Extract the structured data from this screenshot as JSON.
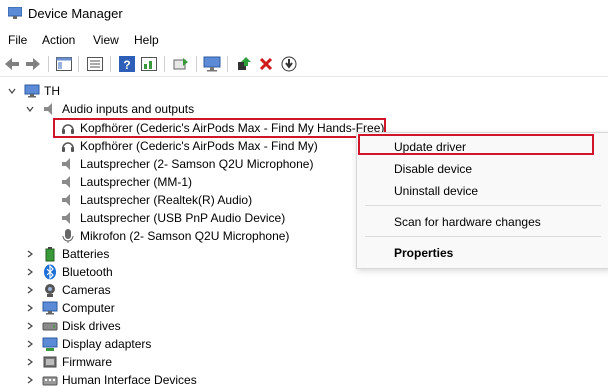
{
  "window": {
    "title": "Device Manager"
  },
  "menu": [
    "File",
    "Action",
    "View",
    "Help"
  ],
  "toolbar": [
    "back-icon",
    "forward-icon",
    "properties-pane-icon",
    "view-icon",
    "help-icon",
    "action-icon",
    "scan-icon",
    "monitor-icon",
    "update-driver-icon",
    "uninstall-icon",
    "download-icon"
  ],
  "tree": {
    "root": "TH",
    "audio_category": "Audio inputs and outputs",
    "audio_devices": [
      "Kopfhörer (Cederic's AirPods Max - Find My Hands-Free)",
      "Kopfhörer (Cederic's AirPods Max - Find My)",
      "Lautsprecher (2- Samson Q2U Microphone)",
      "Lautsprecher (MM-1)",
      "Lautsprecher (Realtek(R) Audio)",
      "Lautsprecher (USB PnP Audio Device)",
      "Mikrofon (2- Samson Q2U Microphone)"
    ],
    "categories": [
      "Batteries",
      "Bluetooth",
      "Cameras",
      "Computer",
      "Disk drives",
      "Display adapters",
      "Firmware",
      "Human Interface Devices"
    ]
  },
  "context_menu": {
    "update_driver": "Update driver",
    "disable_device": "Disable device",
    "uninstall_device": "Uninstall device",
    "scan_hardware": "Scan for hardware changes",
    "properties": "Properties"
  },
  "colors": {
    "highlight_border": "#d0142a"
  }
}
